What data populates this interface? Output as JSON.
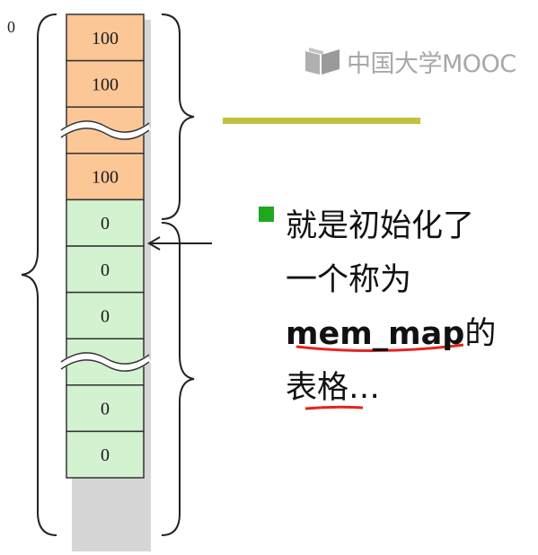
{
  "memory_cells": [
    {
      "value": "100",
      "fill": "#fcc797"
    },
    {
      "value": "100",
      "fill": "#fcc797"
    },
    {
      "value": "",
      "fill": "#fcc797",
      "break": true
    },
    {
      "value": "100",
      "fill": "#fcc797"
    },
    {
      "value": "0",
      "fill": "#d3f2d0"
    },
    {
      "value": "0",
      "fill": "#d3f2d0"
    },
    {
      "value": "0",
      "fill": "#d3f2d0"
    },
    {
      "value": "",
      "fill": "#d3f2d0",
      "break": true
    },
    {
      "value": "0",
      "fill": "#d3f2d0"
    },
    {
      "value": "0",
      "fill": "#d3f2d0"
    }
  ],
  "start_label": "0",
  "brand": {
    "text": "中国大学MOOC",
    "icon": "mooc-logo-icon"
  },
  "bullet": {
    "line1": "就是初始化了",
    "line2": "一个称为",
    "code": "mem_map",
    "line3_suffix": "的",
    "line4": "表格…"
  },
  "colors": {
    "accent_line": "#c3c03e",
    "bullet": "#1fa81f",
    "underline": "#e8231e"
  }
}
